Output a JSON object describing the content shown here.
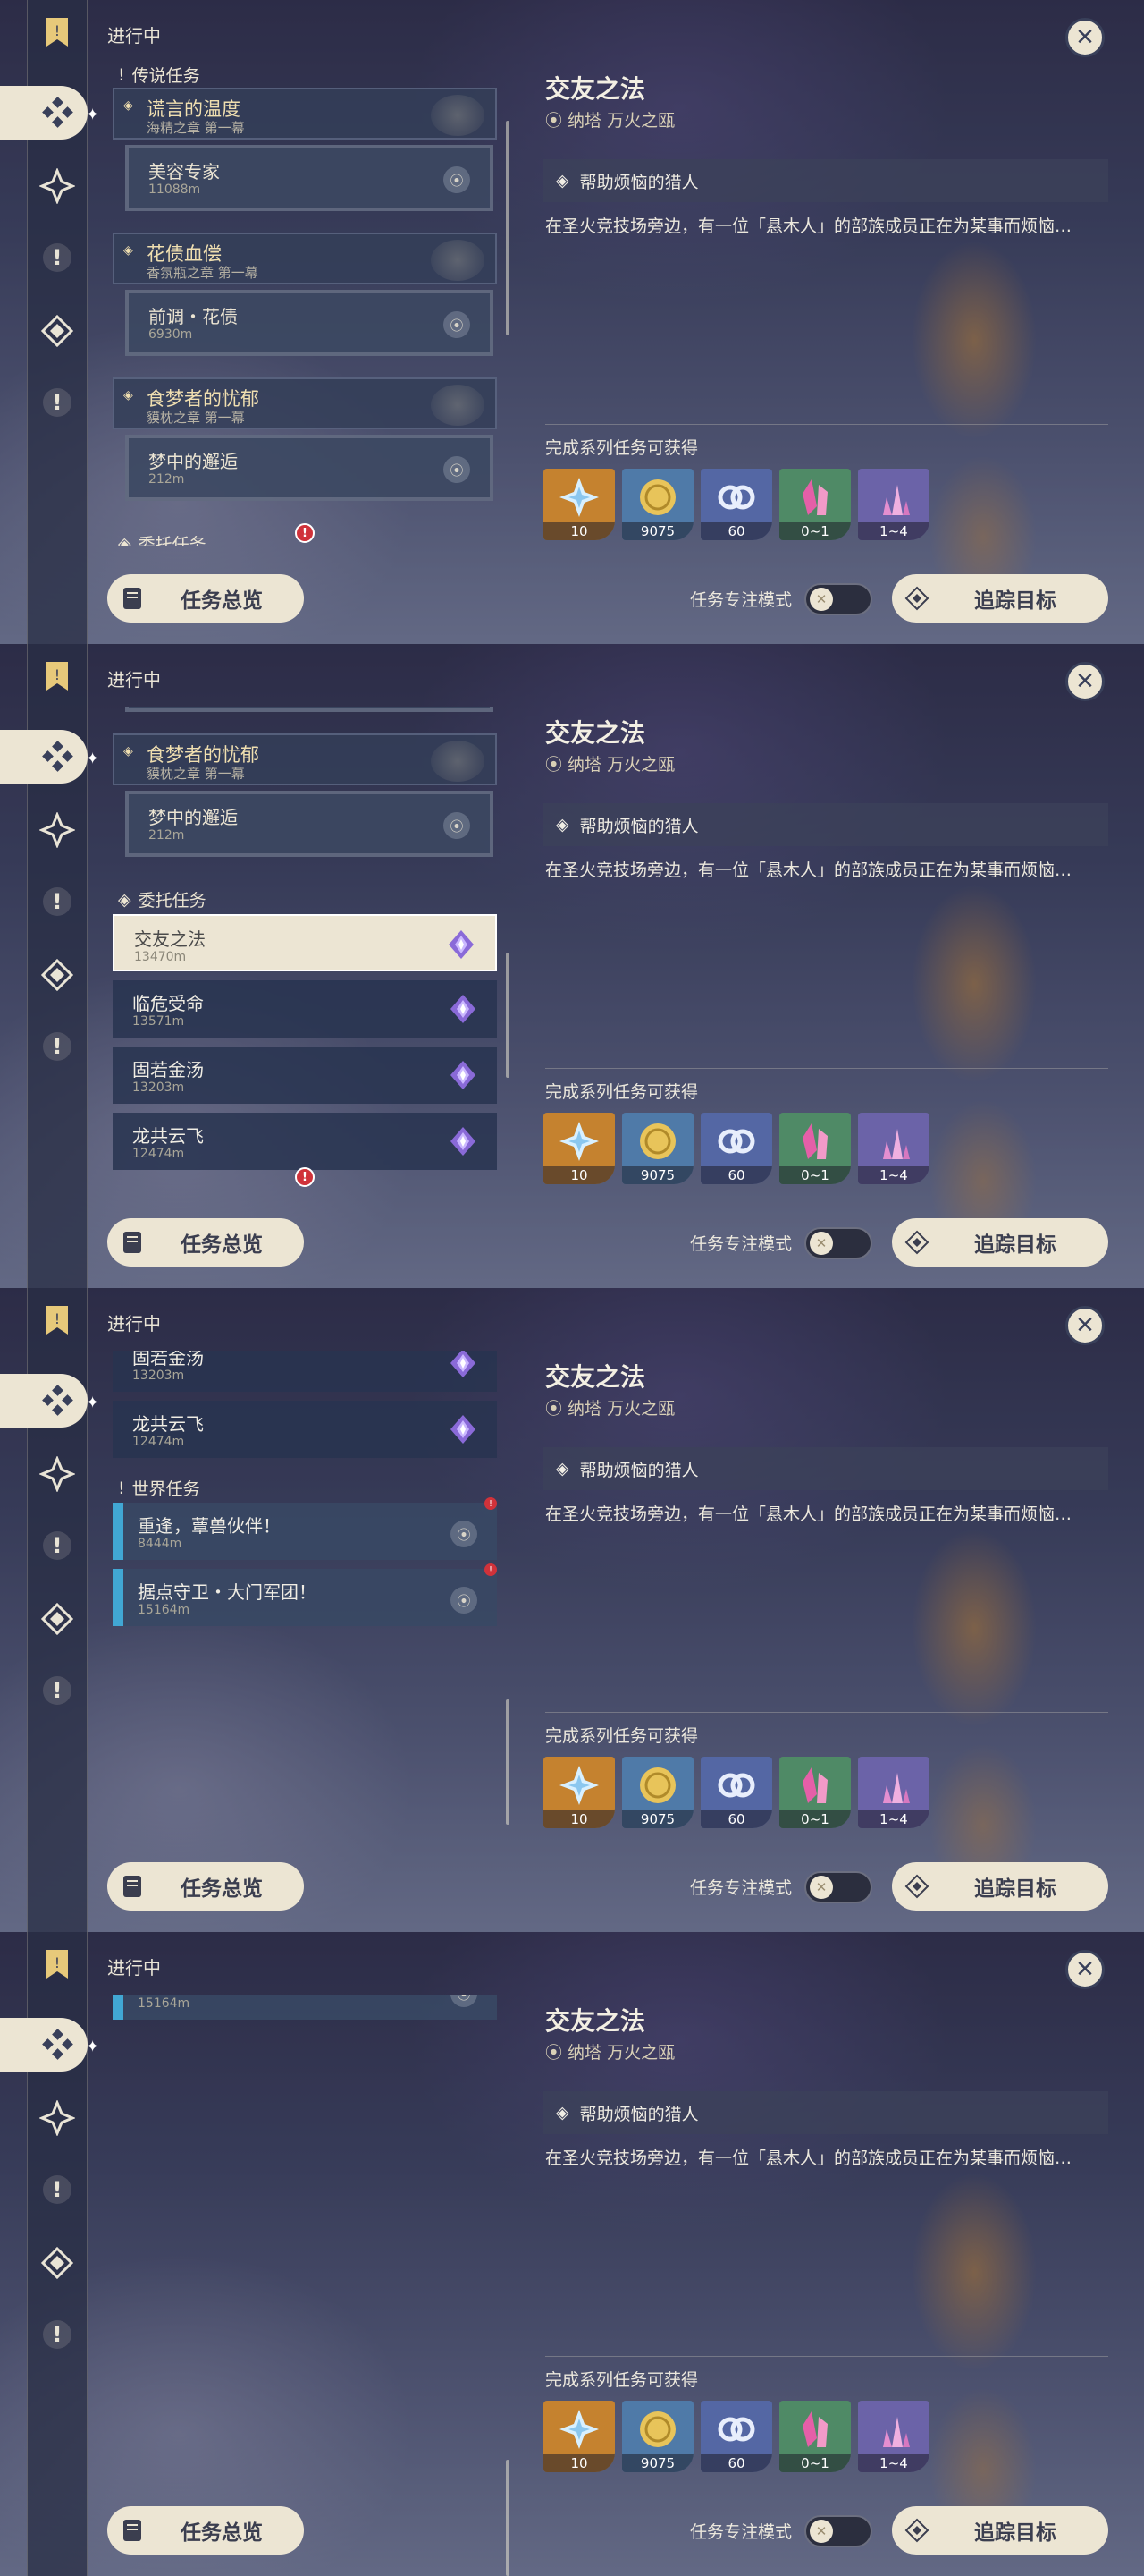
{
  "header": {
    "in_progress": "进行中",
    "close": "✕"
  },
  "legend": {
    "section": "传说任务",
    "quests": [
      {
        "title": "谎言的温度",
        "chapter": "海精之章 第一幕",
        "sub_title": "美容专家",
        "sub_dist": "11088m"
      },
      {
        "title": "花债血偿",
        "chapter": "香氛瓶之章 第一幕",
        "sub_title": "前调・花债",
        "sub_dist": "6930m"
      },
      {
        "title": "食梦者的忧郁",
        "chapter": "貘枕之章 第一幕",
        "sub_title": "梦中的邂逅",
        "sub_dist": "212m"
      }
    ]
  },
  "commission": {
    "section": "委托任务",
    "items": [
      {
        "title": "交友之法",
        "dist": "13470m"
      },
      {
        "title": "临危受命",
        "dist": "13571m"
      },
      {
        "title": "固若金汤",
        "dist": "13203m"
      },
      {
        "title": "龙共云飞",
        "dist": "12474m"
      }
    ]
  },
  "world": {
    "section": "世界任务",
    "items": [
      {
        "title": "重逢，蕈兽伙伴！",
        "dist": "8444m"
      },
      {
        "title": "据点守卫・大门军团！",
        "dist": "15164m"
      }
    ]
  },
  "detail": {
    "title": "交友之法",
    "location": "纳塔 万火之瓯",
    "objective": "帮助烦恼的猎人",
    "description": "在圣火竞技场旁边，有一位「悬木人」的部族成员正在为某事而烦恼…",
    "reward_label": "完成系列任务可获得",
    "rewards": [
      {
        "icon": "primogem-icon",
        "qty": "10",
        "bg": "#c5822f"
      },
      {
        "icon": "mora-icon",
        "qty": "9075",
        "bg": "#4f7aa8"
      },
      {
        "icon": "companionship-icon",
        "qty": "60",
        "bg": "#5467a4"
      },
      {
        "icon": "crystal-icon",
        "qty": "0~1",
        "bg": "#4f8a66"
      },
      {
        "icon": "crystal-shard-icon",
        "qty": "1~4",
        "bg": "#6b63a8"
      }
    ]
  },
  "footer": {
    "overview": "任务总览",
    "focus_mode": "任务专注模式",
    "track": "追踪目标"
  },
  "colors": {
    "panel": "#ece5d3",
    "accent_blue": "#41a7d3",
    "badge": "#d0323a"
  }
}
